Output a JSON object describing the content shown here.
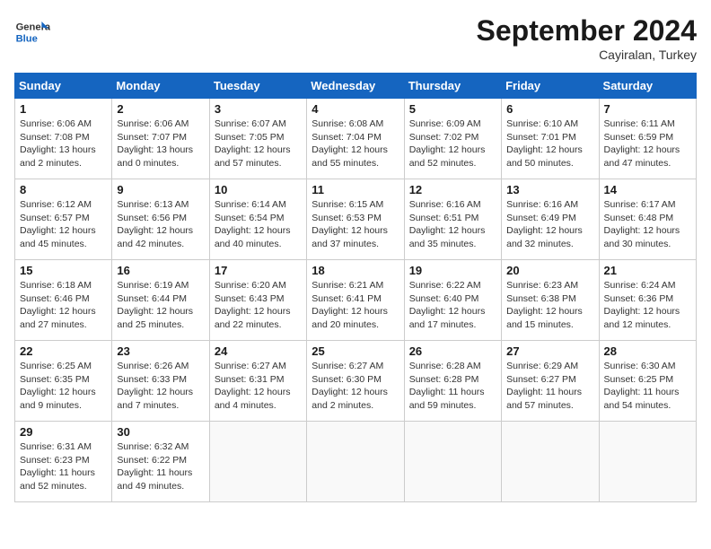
{
  "logo": {
    "general": "General",
    "blue": "Blue"
  },
  "title": "September 2024",
  "subtitle": "Cayiralan, Turkey",
  "days_header": [
    "Sunday",
    "Monday",
    "Tuesday",
    "Wednesday",
    "Thursday",
    "Friday",
    "Saturday"
  ],
  "weeks": [
    [
      {
        "day": "1",
        "sunrise": "6:06 AM",
        "sunset": "7:08 PM",
        "daylight": "13 hours and 2 minutes."
      },
      {
        "day": "2",
        "sunrise": "6:06 AM",
        "sunset": "7:07 PM",
        "daylight": "13 hours and 0 minutes."
      },
      {
        "day": "3",
        "sunrise": "6:07 AM",
        "sunset": "7:05 PM",
        "daylight": "12 hours and 57 minutes."
      },
      {
        "day": "4",
        "sunrise": "6:08 AM",
        "sunset": "7:04 PM",
        "daylight": "12 hours and 55 minutes."
      },
      {
        "day": "5",
        "sunrise": "6:09 AM",
        "sunset": "7:02 PM",
        "daylight": "12 hours and 52 minutes."
      },
      {
        "day": "6",
        "sunrise": "6:10 AM",
        "sunset": "7:01 PM",
        "daylight": "12 hours and 50 minutes."
      },
      {
        "day": "7",
        "sunrise": "6:11 AM",
        "sunset": "6:59 PM",
        "daylight": "12 hours and 47 minutes."
      }
    ],
    [
      {
        "day": "8",
        "sunrise": "6:12 AM",
        "sunset": "6:57 PM",
        "daylight": "12 hours and 45 minutes."
      },
      {
        "day": "9",
        "sunrise": "6:13 AM",
        "sunset": "6:56 PM",
        "daylight": "12 hours and 42 minutes."
      },
      {
        "day": "10",
        "sunrise": "6:14 AM",
        "sunset": "6:54 PM",
        "daylight": "12 hours and 40 minutes."
      },
      {
        "day": "11",
        "sunrise": "6:15 AM",
        "sunset": "6:53 PM",
        "daylight": "12 hours and 37 minutes."
      },
      {
        "day": "12",
        "sunrise": "6:16 AM",
        "sunset": "6:51 PM",
        "daylight": "12 hours and 35 minutes."
      },
      {
        "day": "13",
        "sunrise": "6:16 AM",
        "sunset": "6:49 PM",
        "daylight": "12 hours and 32 minutes."
      },
      {
        "day": "14",
        "sunrise": "6:17 AM",
        "sunset": "6:48 PM",
        "daylight": "12 hours and 30 minutes."
      }
    ],
    [
      {
        "day": "15",
        "sunrise": "6:18 AM",
        "sunset": "6:46 PM",
        "daylight": "12 hours and 27 minutes."
      },
      {
        "day": "16",
        "sunrise": "6:19 AM",
        "sunset": "6:44 PM",
        "daylight": "12 hours and 25 minutes."
      },
      {
        "day": "17",
        "sunrise": "6:20 AM",
        "sunset": "6:43 PM",
        "daylight": "12 hours and 22 minutes."
      },
      {
        "day": "18",
        "sunrise": "6:21 AM",
        "sunset": "6:41 PM",
        "daylight": "12 hours and 20 minutes."
      },
      {
        "day": "19",
        "sunrise": "6:22 AM",
        "sunset": "6:40 PM",
        "daylight": "12 hours and 17 minutes."
      },
      {
        "day": "20",
        "sunrise": "6:23 AM",
        "sunset": "6:38 PM",
        "daylight": "12 hours and 15 minutes."
      },
      {
        "day": "21",
        "sunrise": "6:24 AM",
        "sunset": "6:36 PM",
        "daylight": "12 hours and 12 minutes."
      }
    ],
    [
      {
        "day": "22",
        "sunrise": "6:25 AM",
        "sunset": "6:35 PM",
        "daylight": "12 hours and 9 minutes."
      },
      {
        "day": "23",
        "sunrise": "6:26 AM",
        "sunset": "6:33 PM",
        "daylight": "12 hours and 7 minutes."
      },
      {
        "day": "24",
        "sunrise": "6:27 AM",
        "sunset": "6:31 PM",
        "daylight": "12 hours and 4 minutes."
      },
      {
        "day": "25",
        "sunrise": "6:27 AM",
        "sunset": "6:30 PM",
        "daylight": "12 hours and 2 minutes."
      },
      {
        "day": "26",
        "sunrise": "6:28 AM",
        "sunset": "6:28 PM",
        "daylight": "11 hours and 59 minutes."
      },
      {
        "day": "27",
        "sunrise": "6:29 AM",
        "sunset": "6:27 PM",
        "daylight": "11 hours and 57 minutes."
      },
      {
        "day": "28",
        "sunrise": "6:30 AM",
        "sunset": "6:25 PM",
        "daylight": "11 hours and 54 minutes."
      }
    ],
    [
      {
        "day": "29",
        "sunrise": "6:31 AM",
        "sunset": "6:23 PM",
        "daylight": "11 hours and 52 minutes."
      },
      {
        "day": "30",
        "sunrise": "6:32 AM",
        "sunset": "6:22 PM",
        "daylight": "11 hours and 49 minutes."
      },
      null,
      null,
      null,
      null,
      null
    ]
  ]
}
